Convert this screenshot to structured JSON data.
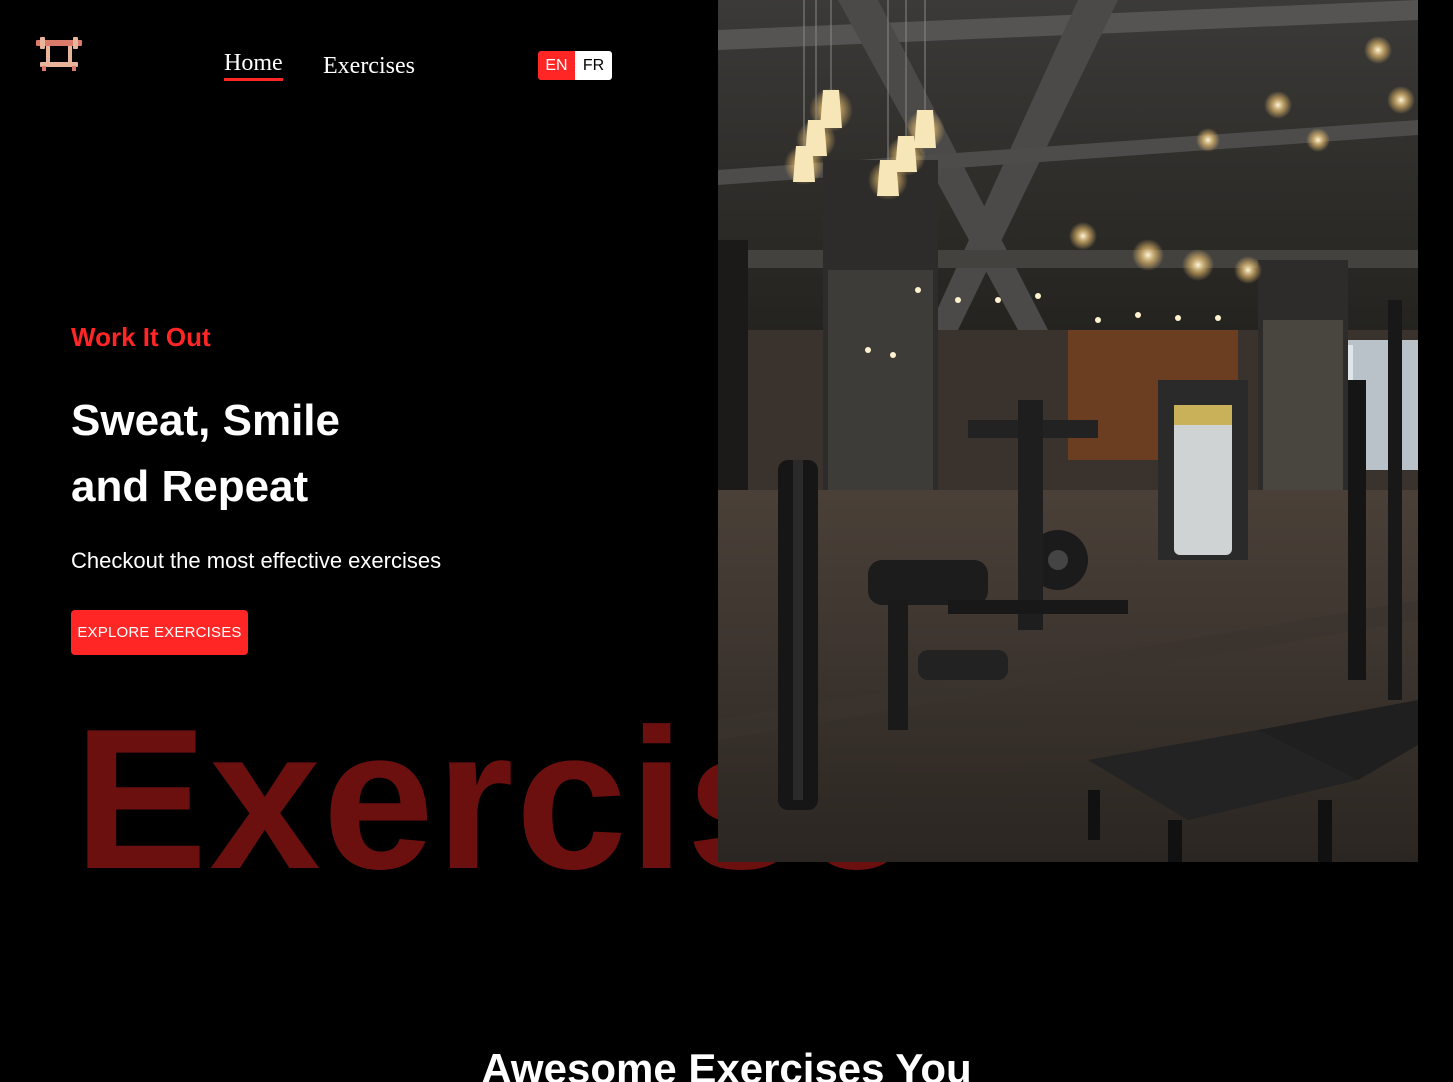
{
  "navbar": {
    "logo_icon": "barbell-icon",
    "links": [
      {
        "label": "Home",
        "active": true
      },
      {
        "label": "Exercises",
        "active": false
      }
    ],
    "languages": [
      {
        "code": "EN",
        "active": true
      },
      {
        "code": "FR",
        "active": false
      }
    ]
  },
  "hero": {
    "eyebrow": "Work It Out",
    "title_line1": "Sweat, Smile",
    "title_line2": "and Repeat",
    "subtitle": "Checkout the most effective exercises",
    "cta_label": "EXPLORE EXERCISES",
    "watermark": "Exercise"
  },
  "section": {
    "heading": "Awesome Exercises You"
  },
  "colors": {
    "accent": "#ff2625",
    "background": "#000000",
    "text": "#ffffff"
  }
}
